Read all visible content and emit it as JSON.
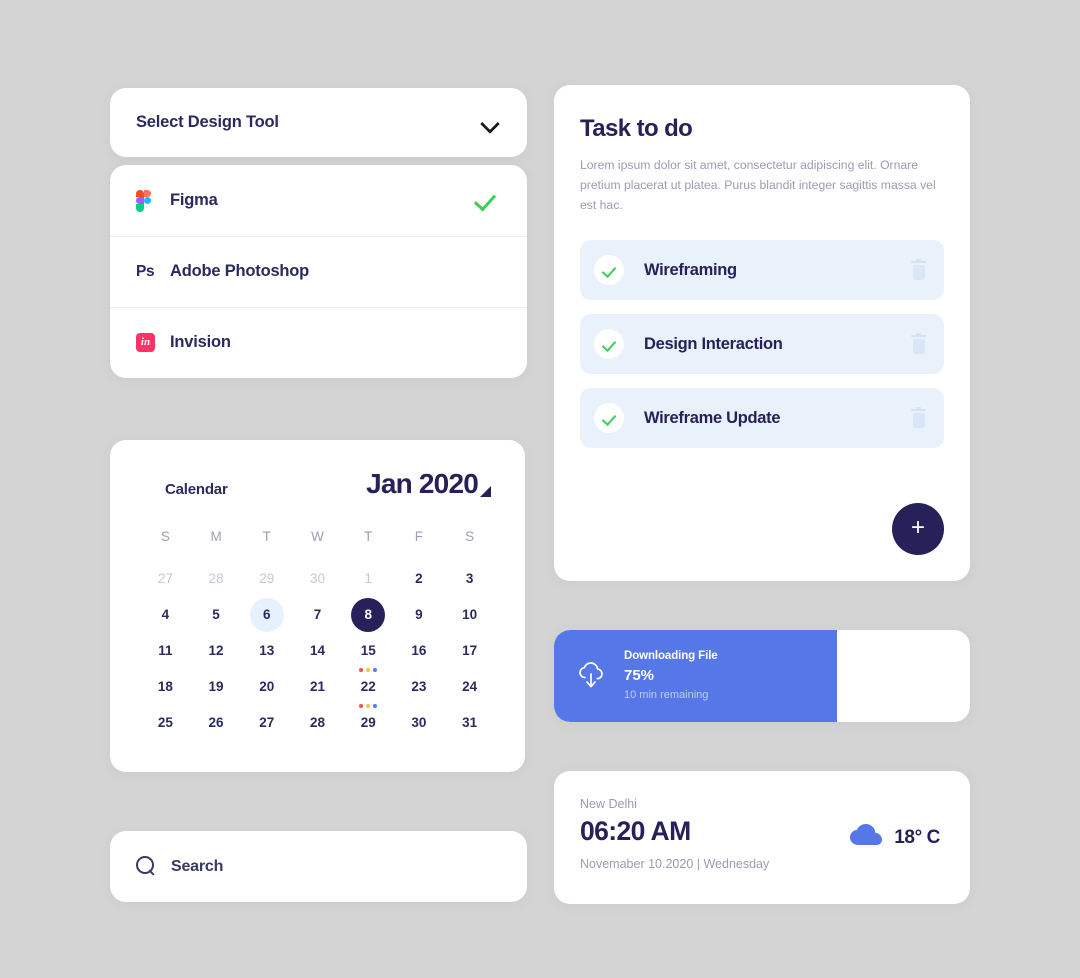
{
  "theme": {
    "background": "#d4d4d4",
    "card_bg": "#ffffff",
    "navy": "#262159",
    "muted": "#9b9bb4",
    "accent_blue": "#5577e8",
    "task_row_bg": "#e9f1fb",
    "green": "#3ccf5a"
  },
  "select_tool": {
    "label": "Select Design Tool",
    "chevron_icon": "chevron-down-icon"
  },
  "tool_list": {
    "items": [
      {
        "name": "Figma",
        "icon": "figma-icon",
        "selected": true
      },
      {
        "name": "Adobe Photoshop",
        "icon": "photoshop-icon",
        "selected": false
      },
      {
        "name": "Invision",
        "icon": "invision-icon",
        "selected": false
      }
    ],
    "photoshop_mark": "Ps",
    "invision_mark": "in"
  },
  "calendar": {
    "title": "Calendar",
    "month": "Jan 2020",
    "caret_icon": "triangle-caret-icon",
    "weekdays": [
      "S",
      "M",
      "T",
      "W",
      "T",
      "F",
      "S"
    ],
    "weeks": [
      [
        {
          "n": "27",
          "state": "muted"
        },
        {
          "n": "28",
          "state": "muted"
        },
        {
          "n": "29",
          "state": "muted"
        },
        {
          "n": "30",
          "state": "muted"
        },
        {
          "n": "1",
          "state": "muted"
        },
        {
          "n": "2",
          "state": "normal"
        },
        {
          "n": "3",
          "state": "normal"
        }
      ],
      [
        {
          "n": "4",
          "state": "normal"
        },
        {
          "n": "5",
          "state": "normal"
        },
        {
          "n": "6",
          "state": "soft"
        },
        {
          "n": "7",
          "state": "normal"
        },
        {
          "n": "8",
          "state": "today"
        },
        {
          "n": "9",
          "state": "normal"
        },
        {
          "n": "10",
          "state": "normal"
        }
      ],
      [
        {
          "n": "11",
          "state": "normal"
        },
        {
          "n": "12",
          "state": "normal"
        },
        {
          "n": "13",
          "state": "normal"
        },
        {
          "n": "14",
          "state": "normal"
        },
        {
          "n": "15",
          "state": "normal",
          "dots": [
            "#f2543d",
            "#f6c343",
            "#4f7df3"
          ]
        },
        {
          "n": "16",
          "state": "normal"
        },
        {
          "n": "17",
          "state": "normal"
        }
      ],
      [
        {
          "n": "18",
          "state": "normal"
        },
        {
          "n": "19",
          "state": "normal"
        },
        {
          "n": "20",
          "state": "normal"
        },
        {
          "n": "21",
          "state": "normal"
        },
        {
          "n": "22",
          "state": "normal",
          "dots": [
            "#f2543d",
            "#f6c343",
            "#4f7df3"
          ]
        },
        {
          "n": "23",
          "state": "normal"
        },
        {
          "n": "24",
          "state": "normal"
        }
      ],
      [
        {
          "n": "25",
          "state": "normal"
        },
        {
          "n": "26",
          "state": "normal"
        },
        {
          "n": "27",
          "state": "normal"
        },
        {
          "n": "28",
          "state": "normal"
        },
        {
          "n": "29",
          "state": "normal"
        },
        {
          "n": "30",
          "state": "normal"
        },
        {
          "n": "31",
          "state": "normal"
        }
      ]
    ]
  },
  "search": {
    "icon": "search-icon",
    "placeholder": "Search",
    "value": ""
  },
  "task": {
    "title": "Task to do",
    "description": "Lorem ipsum dolor sit amet, consectetur adipiscing elit. Ornare pretium placerat ut platea. Purus blandit integer sagittis massa vel est hac.",
    "items": [
      {
        "label": "Wireframing",
        "done": true,
        "delete_icon": "trash-icon"
      },
      {
        "label": "Design Interaction",
        "done": true,
        "delete_icon": "trash-icon"
      },
      {
        "label": "Wireframe Update",
        "done": true,
        "delete_icon": "trash-icon"
      }
    ],
    "add_button_label": "+"
  },
  "download": {
    "icon": "cloud-download-icon",
    "title": "Downloading File",
    "percent": "75%",
    "progress_value": 75,
    "remaining": "10 min remaining"
  },
  "weather": {
    "city": "New Delhi",
    "time": "06:20 AM",
    "date": "Novemaber 10.2020 | Wednesday",
    "icon": "cloud-icon",
    "temperature": "18° C"
  }
}
